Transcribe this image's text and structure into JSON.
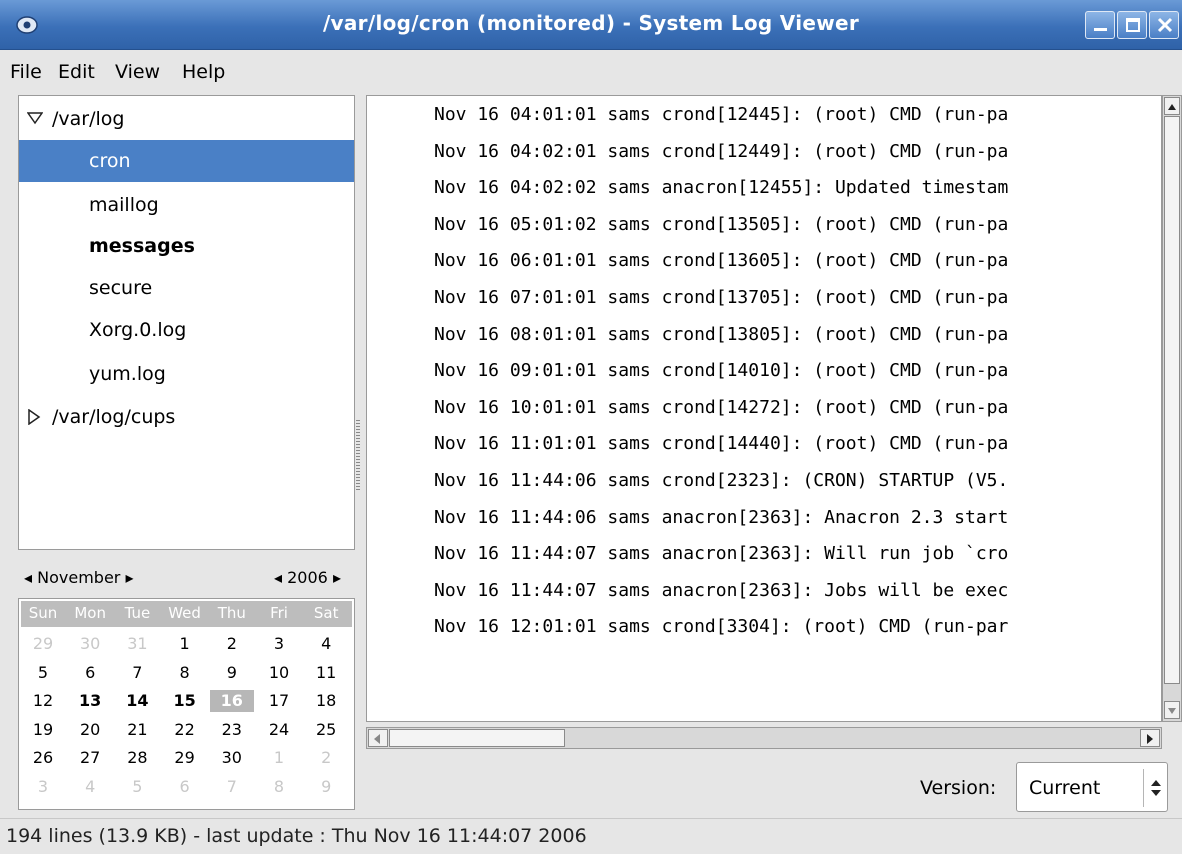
{
  "window": {
    "title": "/var/log/cron (monitored) - System Log Viewer"
  },
  "menu": [
    {
      "label": "File"
    },
    {
      "label": "Edit"
    },
    {
      "label": "View"
    },
    {
      "label": "Help"
    }
  ],
  "tree": {
    "root1": "/var/log",
    "items": [
      "cron",
      "maillog",
      "messages",
      "secure",
      "Xorg.0.log",
      "yum.log"
    ],
    "selected": "cron",
    "bold": "messages",
    "root2": "/var/log/cups"
  },
  "calendar": {
    "month": "November",
    "year": "2006",
    "daynames": [
      "Sun",
      "Mon",
      "Tue",
      "Wed",
      "Thu",
      "Fri",
      "Sat"
    ],
    "weeks": [
      [
        "29",
        "30",
        "31",
        "1",
        "2",
        "3",
        "4"
      ],
      [
        "5",
        "6",
        "7",
        "8",
        "9",
        "10",
        "11"
      ],
      [
        "12",
        "13",
        "14",
        "15",
        "16",
        "17",
        "18"
      ],
      [
        "19",
        "20",
        "21",
        "22",
        "23",
        "24",
        "25"
      ],
      [
        "26",
        "27",
        "28",
        "29",
        "30",
        "1",
        "2"
      ],
      [
        "3",
        "4",
        "5",
        "6",
        "7",
        "8",
        "9"
      ]
    ],
    "today": "16",
    "marked": [
      "13",
      "14",
      "15"
    ]
  },
  "log_lines": [
    "Nov 16 04:01:01 sams crond[12445]: (root) CMD (run-pa",
    "Nov 16 04:02:01 sams crond[12449]: (root) CMD (run-pa",
    "Nov 16 04:02:02 sams anacron[12455]: Updated timestam",
    "Nov 16 05:01:02 sams crond[13505]: (root) CMD (run-pa",
    "Nov 16 06:01:01 sams crond[13605]: (root) CMD (run-pa",
    "Nov 16 07:01:01 sams crond[13705]: (root) CMD (run-pa",
    "Nov 16 08:01:01 sams crond[13805]: (root) CMD (run-pa",
    "Nov 16 09:01:01 sams crond[14010]: (root) CMD (run-pa",
    "Nov 16 10:01:01 sams crond[14272]: (root) CMD (run-pa",
    "Nov 16 11:01:01 sams crond[14440]: (root) CMD (run-pa",
    "Nov 16 11:44:06 sams crond[2323]: (CRON) STARTUP (V5.",
    "Nov 16 11:44:06 sams anacron[2363]: Anacron 2.3 start",
    "Nov 16 11:44:07 sams anacron[2363]: Will run job `cro",
    "Nov 16 11:44:07 sams anacron[2363]: Jobs will be exec",
    "Nov 16 12:01:01 sams crond[3304]: (root) CMD (run-par"
  ],
  "version": {
    "label": "Version:",
    "value": "Current"
  },
  "status": "194 lines (13.9 KB) - last update : Thu Nov 16 11:44:07 2006",
  "colors": {
    "titlebar": "#3b70b8",
    "selection": "#4a80c6"
  }
}
